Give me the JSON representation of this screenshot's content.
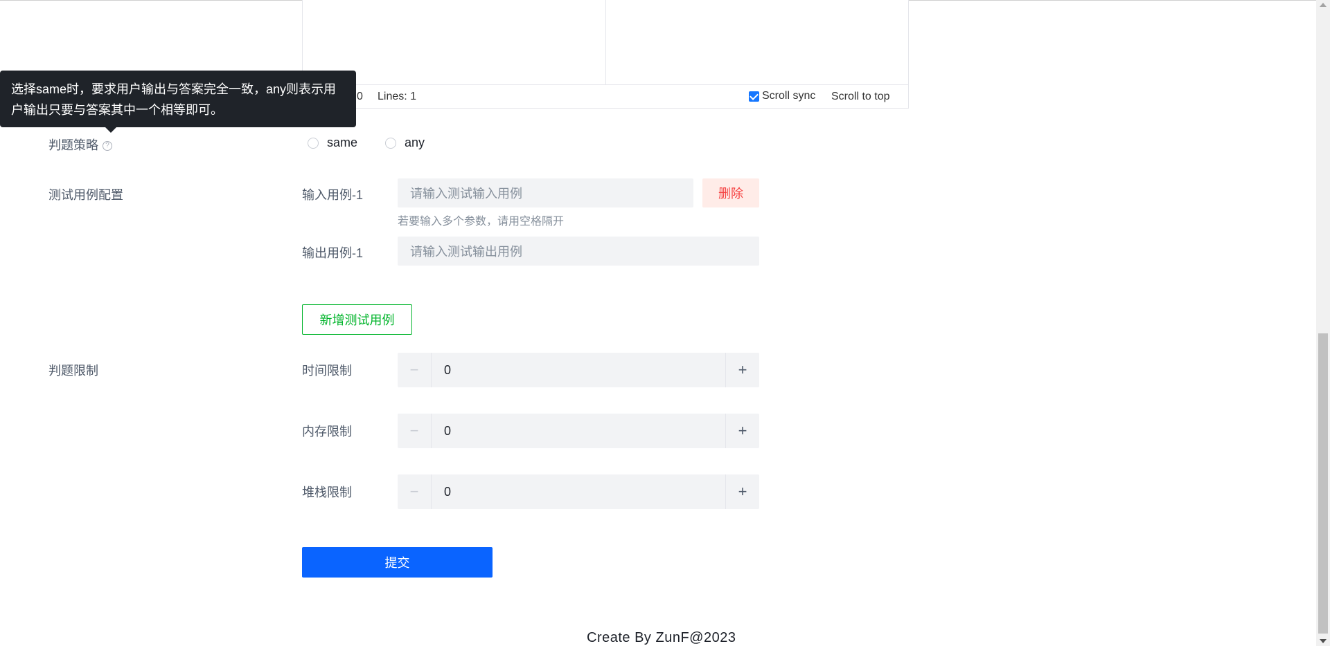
{
  "editor": {
    "chars_value": "0",
    "lines_label": "Lines: 1",
    "scroll_sync_label": "Scroll sync",
    "scroll_sync_checked": true,
    "scroll_to_top_label": "Scroll to top"
  },
  "tooltip": {
    "text": "选择same时，要求用户输出与答案完全一致，any则表示用户输出只要与答案其中一个相等即可。"
  },
  "judge_strategy": {
    "label": "判题策略",
    "help_icon": "question-circle-icon",
    "options": [
      "same",
      "any"
    ]
  },
  "test_cases": {
    "label": "测试用例配置",
    "input_label": "输入用例-1",
    "input_placeholder": "请输入测试输入用例",
    "input_hint": "若要输入多个参数，请用空格隔开",
    "delete_label": "删除",
    "output_label": "输出用例-1",
    "output_placeholder": "请输入测试输出用例",
    "add_label": "新增测试用例"
  },
  "judge_limits": {
    "label": "判题限制",
    "time_label": "时间限制",
    "time_value": "0",
    "memory_label": "内存限制",
    "memory_value": "0",
    "stack_label": "堆栈限制",
    "stack_value": "0"
  },
  "submit_label": "提交",
  "footer": "Create By ZunF@2023",
  "colors": {
    "primary": "#0a64ff",
    "success": "#00b42a",
    "danger": "#f53f3f",
    "tooltip_bg": "#1f2329"
  }
}
